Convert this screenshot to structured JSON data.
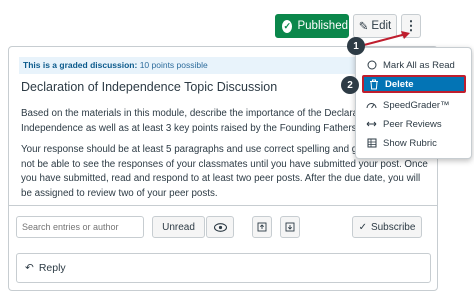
{
  "header": {
    "published_label": "Published",
    "edit_label": "Edit",
    "more_label": "⋮"
  },
  "discussion": {
    "graded_prefix": "This is a graded discussion:",
    "graded_points": "10 points possible",
    "title": "Declaration of Independence Topic Discussion",
    "paragraphs": [
      "Based on the materials in this module, describe the importance of the Declaratio",
      "Independence as well as at least 3 key points raised by the Founding Fathers.",
      "Your response should be at least 5 paragraphs and use correct spelling and gram",
      "not be able to see the responses of your classmates until you have submitted your post. Once",
      "you have submitted, read and respond to at least two peer posts. After the due date, you will",
      "be assigned to review two of your peer posts."
    ]
  },
  "toolbar": {
    "search_placeholder": "Search entries or author",
    "unread_label": "Unread",
    "subscribe_label": "Subscribe"
  },
  "reply": {
    "label": "Reply"
  },
  "menu": {
    "items": [
      {
        "label": "Mark All as Read",
        "icon": "circle-icon"
      },
      {
        "label": "Delete",
        "icon": "trash-icon"
      },
      {
        "label": "SpeedGrader™",
        "icon": "speedgrader-icon"
      },
      {
        "label": "Peer Reviews",
        "icon": "peer-reviews-icon"
      },
      {
        "label": "Show Rubric",
        "icon": "rubric-icon"
      }
    ]
  },
  "callouts": {
    "one": "1",
    "two": "2"
  },
  "colors": {
    "published_green": "#0b874b",
    "highlight_blue": "#0374b5",
    "callout_red": "#bf1e2e"
  }
}
